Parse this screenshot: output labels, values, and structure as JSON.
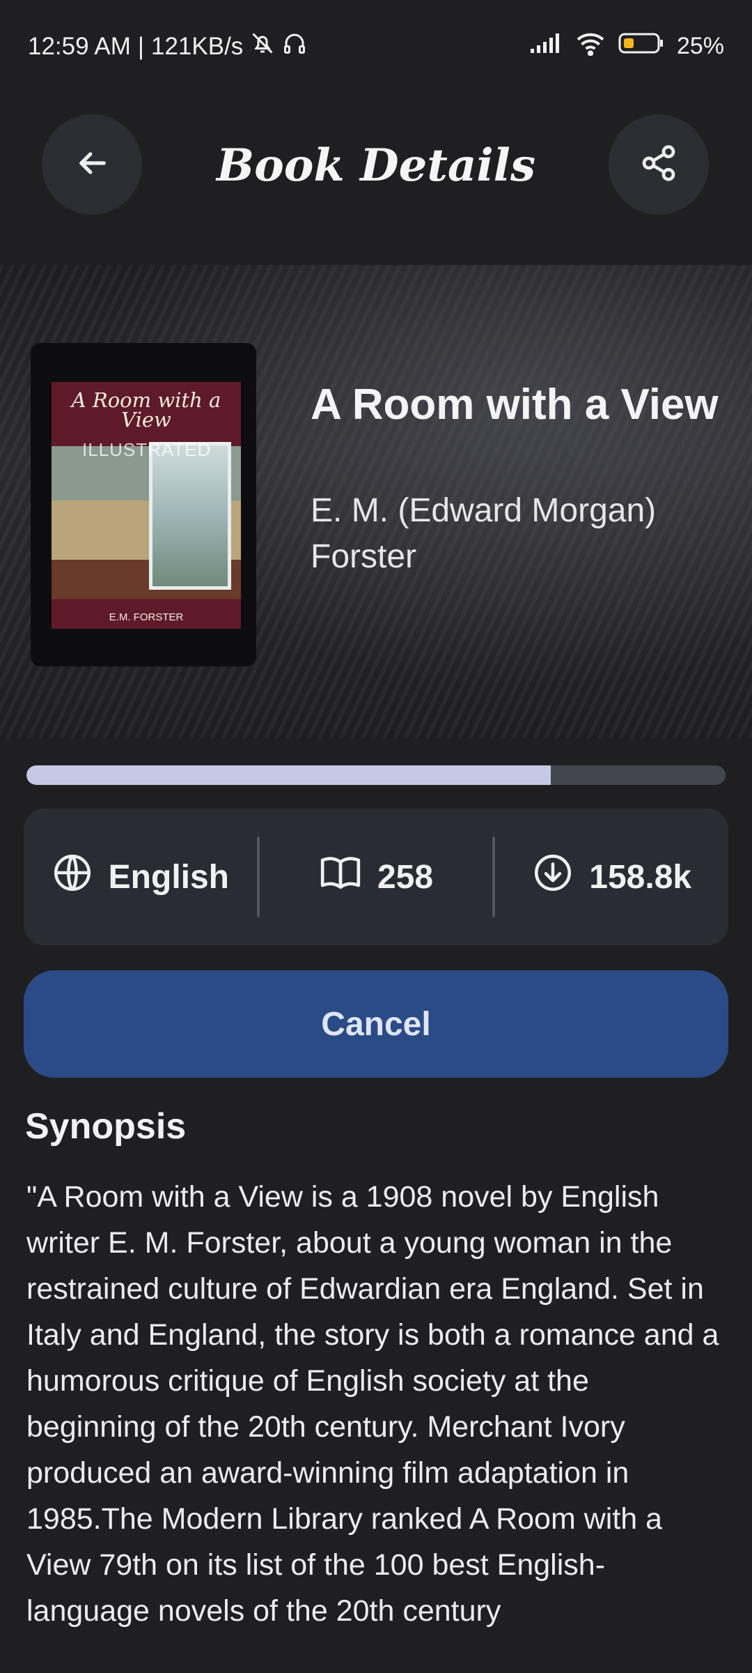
{
  "status_bar": {
    "time": "12:59 AM",
    "speed": "121KB/s",
    "battery": "25%"
  },
  "header": {
    "title": "Book Details"
  },
  "book": {
    "cover_title": "A Room with a View",
    "cover_subtitle": "ILLUSTRATED",
    "cover_author": "E.M. FORSTER",
    "title": "A Room with a View",
    "author": "E. M. (Edward Morgan) Forster",
    "progress_fraction": 0.75
  },
  "stats": {
    "language": "English",
    "pages": "258",
    "downloads": "158.8k"
  },
  "actions": {
    "cancel_label": "Cancel"
  },
  "synopsis": {
    "heading": "Synopsis",
    "text": "\"A Room with a View is a 1908 novel by English writer E. M. Forster, about a young woman in the restrained culture of Edwardian era England. Set in Italy and England, the story is both a romance and a humorous critique of English society at the beginning of the 20th century. Merchant Ivory produced an award-winning film adaptation in 1985.The Modern Library ranked A Room with a View 79th on its list of the 100 best English-language novels of the 20th century"
  }
}
